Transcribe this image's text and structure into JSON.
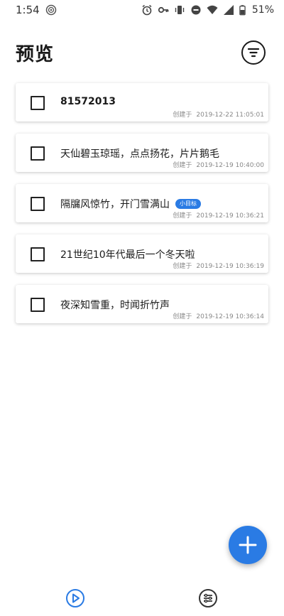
{
  "status_bar": {
    "time": "1:54",
    "battery": "51%"
  },
  "header": {
    "title": "预览"
  },
  "items": [
    {
      "title": "81572013",
      "badge": "",
      "created_label": "创建于",
      "created_at": "2019-12-22 11:05:01"
    },
    {
      "title": "天仙碧玉琼瑶，点点扬花，片片鹅毛",
      "badge": "",
      "created_label": "创建于",
      "created_at": "2019-12-19 10:40:00"
    },
    {
      "title": "隔牖风惊竹，开门雪满山",
      "badge": "小目标",
      "created_label": "创建于",
      "created_at": "2019-12-19 10:36:21"
    },
    {
      "title": "21世纪10年代最后一个冬天啦",
      "badge": "",
      "created_label": "创建于",
      "created_at": "2019-12-19 10:36:19"
    },
    {
      "title": "夜深知雪重，时闻折竹声",
      "badge": "",
      "created_label": "创建于",
      "created_at": "2019-12-19 10:36:14"
    }
  ],
  "icons": {
    "status_left": [
      "podcast-icon"
    ],
    "status_right": [
      "alarm-icon",
      "key-icon",
      "vibrate-icon",
      "do-not-disturb-icon",
      "wifi-icon",
      "signal-icon",
      "battery-icon"
    ],
    "filter": "filter-icon",
    "fab": "plus-icon",
    "nav": [
      "play-icon",
      "sliders-icon"
    ]
  },
  "colors": {
    "accent": "#2a7be4",
    "text": "#1a1a1a",
    "meta": "#888888"
  }
}
